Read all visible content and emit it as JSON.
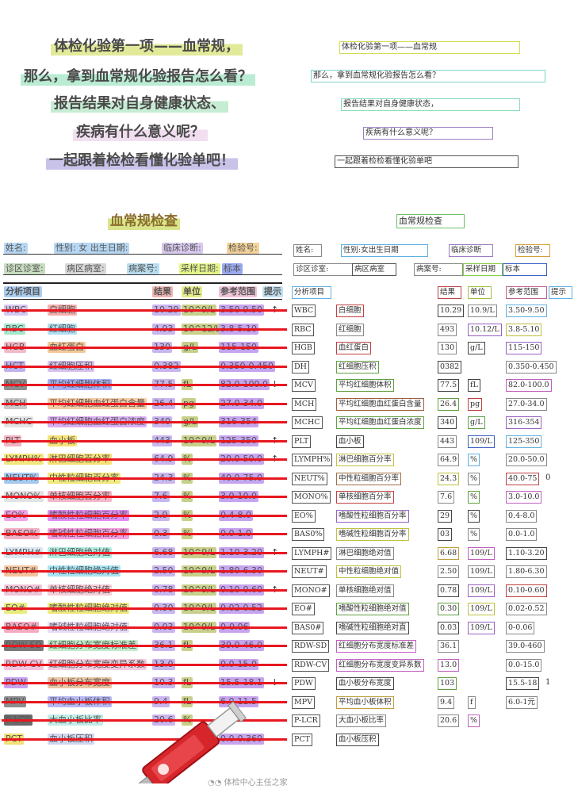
{
  "intro": {
    "line1": "体检化验第一项——血常规，",
    "line2": "那么，拿到血常规化验报告怎么看？",
    "line3": "报告结果对自身健康状态、",
    "line4": "疾病有什么意义呢？",
    "line5": "一起跟着检检看懂化验单吧！"
  },
  "intro_boxes": {
    "line1": "体检化验第一项——血常规",
    "line2": "那么，拿到血常规化验报告怎么看？",
    "line3": "报告结果对自身健康状态，",
    "line4": "疾病有什么意义呢？",
    "line5": "一起跟着检检看懂化验单吧"
  },
  "report": {
    "title": "血常规检查",
    "title_box": "血常规检查",
    "info1": {
      "name": "姓名:",
      "gender_birth": "性别: 女  出生日期:",
      "diagnosis": "临床诊断:",
      "exam_no": "检验号:"
    },
    "info2": {
      "clinic": "诊区诊室:",
      "ward": "病区病室:",
      "case_no": "病案号:",
      "sample_date": "采样日期:",
      "specimen": "标本"
    },
    "info1_boxes": {
      "name": "姓名:",
      "gender_birth": "性别:女出生日期",
      "diagnosis": "临床诊断",
      "exam_no": "检验号:"
    },
    "info2_boxes": {
      "clinic": "诊区诊室:",
      "ward": "病区病室",
      "case_no": "病案号:",
      "sample_date": "采样日期",
      "specimen": "标本"
    },
    "headers": {
      "item": "分析项目",
      "result": "结果",
      "unit": "单位",
      "range": "参考范围",
      "hint": "提示"
    },
    "header_boxes": {
      "item": "分析项目",
      "result": "结果",
      "unit": "单位",
      "range": "参考范围",
      "hint": "提示"
    }
  },
  "rows": [
    {
      "code": "WBC",
      "name": "白细胞",
      "result": "10.29",
      "unit": "10^9/L",
      "range": "3.50-9.50",
      "flag": "↑",
      "r_code": "WBC",
      "r_name": "白细胞",
      "r_result": "10.29",
      "r_unit": "10.9/L",
      "r_range": "3.50-9.50",
      "r_extra": ""
    },
    {
      "code": "RBC",
      "name": "红细胞",
      "result": "4.93",
      "unit": "10^12/L",
      "range": "3.8-5.10",
      "flag": "",
      "r_code": "RBC",
      "r_name": "红细胞",
      "r_result": "493",
      "r_unit": "10.12/L",
      "r_range": "3.8-5.10",
      "r_extra": ""
    },
    {
      "code": "HGB",
      "name": "血红蛋白",
      "result": "130",
      "unit": "g/L",
      "range": "115-150",
      "flag": "",
      "r_code": "HGB",
      "r_name": "血红蛋白",
      "r_result": "130",
      "r_unit": "g/L",
      "r_range": "115-150",
      "r_extra": ""
    },
    {
      "code": "HCT",
      "name": "红细胞压积",
      "result": "0.382",
      "unit": "",
      "range": "0.350-0.450",
      "flag": "",
      "r_code": "DH",
      "r_name": "红细胞压积",
      "r_result": "0382",
      "r_unit": "",
      "r_range": "0.350-0.450",
      "r_extra": ""
    },
    {
      "code": "MCV",
      "name": "平均红细胞体积",
      "result": "77.5",
      "unit": "fL",
      "range": "82.0-100.0",
      "flag": "↓",
      "r_code": "MCV",
      "r_name": "平均红细胞体积",
      "r_result": "77.5",
      "r_unit": "fL",
      "r_range": "82.0-100.0",
      "r_extra": ""
    },
    {
      "code": "MCH",
      "name": "平均红细胞血红蛋白含量",
      "result": "26.4",
      "unit": "pg",
      "range": "27.0-34.0",
      "flag": "",
      "r_code": "MCH",
      "r_name": "平均红细胞血红蛋白含量",
      "r_result": "26.4",
      "r_unit": "pg",
      "r_range": "27.0-34.0",
      "r_extra": ""
    },
    {
      "code": "MCHC",
      "name": "平均红细胞血红蛋白浓度",
      "result": "340",
      "unit": "g/L",
      "range": "316-354",
      "flag": "",
      "r_code": "MCHC",
      "r_name": "平均红细胞血红蛋白浓度",
      "r_result": "340",
      "r_unit": "g/L",
      "r_range": "316-354",
      "r_extra": ""
    },
    {
      "code": "PLT",
      "name": "血小板",
      "result": "443",
      "unit": "10^9/L",
      "range": "125-350",
      "flag": "↑",
      "r_code": "PLT",
      "r_name": "血小板",
      "r_result": "443",
      "r_unit": "109/L",
      "r_range": "125-350",
      "r_extra": ""
    },
    {
      "code": "LYMPH%",
      "name": "淋巴细胞百分率",
      "result": "64.9",
      "unit": "%",
      "range": "20.0-50.0",
      "flag": "↑",
      "r_code": "LYMPH%",
      "r_name": "淋巴细胞百分率",
      "r_result": "64.9",
      "r_unit": "%",
      "r_range": "20.0-50.0",
      "r_extra": ""
    },
    {
      "code": "NEUT%",
      "name": "中性粒细胞百分率",
      "result": "24.3",
      "unit": "%",
      "range": "40.0-75.0",
      "flag": "",
      "r_code": "NEUT%",
      "r_name": "中性粒细胞百分率",
      "r_result": "24.3",
      "r_unit": "%",
      "r_range": "40.0-75",
      "r_extra": "0"
    },
    {
      "code": "MONO%",
      "name": "单核细胞百分率",
      "result": "7.6",
      "unit": "%",
      "range": "3.0-10.0",
      "flag": "",
      "r_code": "MONO%",
      "r_name": "单核细胞百分率",
      "r_result": "7.6",
      "r_unit": "%",
      "r_range": "3.0-10.0",
      "r_extra": ""
    },
    {
      "code": "EO%",
      "name": "嗜酸性粒细胞百分率",
      "result": "2.9",
      "unit": "%",
      "range": "0.4-8.0",
      "flag": "",
      "r_code": "EO%",
      "r_name": "嗜酸性粒细胞百分率",
      "r_result": "29",
      "r_unit": "%",
      "r_range": "0.4-8.0",
      "r_extra": ""
    },
    {
      "code": "BASO%",
      "name": "嗜碱性粒细胞百分率",
      "result": "0.3",
      "unit": "%",
      "range": "0.0-1.0",
      "flag": "",
      "r_code": "BAS0%",
      "r_name": "嗜碱性粒细胞百分率",
      "r_result": "03",
      "r_unit": "%",
      "r_range": "0.0-1.0",
      "r_extra": ""
    },
    {
      "code": "LYMPH#",
      "name": "淋巴细胞绝对值",
      "result": "6.68",
      "unit": "10^9/L",
      "range": "1.10-3.20",
      "flag": "↑",
      "r_code": "LYMPH#",
      "r_name": "淋巴细胞绝对值",
      "r_result": "6.68",
      "r_unit": "109/L",
      "r_range": "1.10-3.20",
      "r_extra": ""
    },
    {
      "code": "NEUT#",
      "name": "中性粒细胞绝对值",
      "result": "2.50",
      "unit": "10^9/L",
      "range": "1.80-6.30",
      "flag": "",
      "r_code": "NEUT#",
      "r_name": "中性粒细胞绝对值",
      "r_result": "2.50",
      "r_unit": "109/L",
      "r_range": "1.80-6.30",
      "r_extra": ""
    },
    {
      "code": "MONO#",
      "name": "单核细胞绝对值",
      "result": "0.78",
      "unit": "10^9/L",
      "range": "0.10-0.60",
      "flag": "↑",
      "r_code": "MONO#",
      "r_name": "单核细胞绝对值",
      "r_result": "0.78",
      "r_unit": "109/L",
      "r_range": "0.10-0.60",
      "r_extra": ""
    },
    {
      "code": "EO#",
      "name": "嗜酸性粒细胞绝对值",
      "result": "0.30",
      "unit": "10^9/L",
      "range": "0.02-0.52",
      "flag": "",
      "r_code": "EO#",
      "r_name": "嗜酸性粒细胞绝对值",
      "r_result": "0.30",
      "r_unit": "109/L",
      "r_range": "0.02-0.52",
      "r_extra": ""
    },
    {
      "code": "BASO#",
      "name": "嗜碱性粒细胞绝对值",
      "result": "0.03",
      "unit": "10^9/L",
      "range": "0-0.06",
      "flag": "",
      "r_code": "BAS0#",
      "r_name": "嗜碱性粒细胞绝对直",
      "r_result": "0.03",
      "r_unit": "109/L",
      "r_range": "0-0.06",
      "r_extra": ""
    },
    {
      "code": "RDW-SD",
      "name": "红细胞分布宽度标准差",
      "result": "36.1",
      "unit": "fL",
      "range": "39.0-46.0",
      "flag": "",
      "r_code": "RDW-SD",
      "r_name": "红细胞分布宽度标准差",
      "r_result": "36.1",
      "r_unit": "",
      "r_range": "39.0-460",
      "r_extra": ""
    },
    {
      "code": "RDW-CV",
      "name": "红细胞分布宽度变异系数",
      "result": "13.0",
      "unit": "",
      "range": "0.0-15.0",
      "flag": "",
      "r_code": "RDW-CV",
      "r_name": "红细胞分布宽度变异系数",
      "r_result": "13.0",
      "r_unit": "",
      "r_range": "0.0-15.0",
      "r_extra": ""
    },
    {
      "code": "PDW",
      "name": "血小板分布宽度",
      "result": "10.3",
      "unit": "fL",
      "range": "15.5-18.1",
      "flag": "↓",
      "r_code": "PDW",
      "r_name": "血小板分布宽度",
      "r_result": "103",
      "r_unit": "",
      "r_range": "15.5-18",
      "r_extra": "1"
    },
    {
      "code": "MPV",
      "name": "平均血小板体积",
      "result": "9.4",
      "unit": "fL",
      "range": "6.0-11.5",
      "flag": "",
      "r_code": "MPV",
      "r_name": "平均血小板体积",
      "r_result": "9.4",
      "r_unit": "f",
      "r_range": "6.0-1元",
      "r_extra": ""
    },
    {
      "code": "P-LCR",
      "name": "大血小板比率",
      "result": "20.6",
      "unit": "%",
      "range": "",
      "flag": "",
      "r_code": "P-LCR",
      "r_name": "大血小板比率",
      "r_result": "20.6",
      "r_unit": "%",
      "r_range": "",
      "r_extra": ""
    },
    {
      "code": "PCT",
      "name": "血小板压积",
      "result": "",
      "unit": "",
      "range": "0.0-0.360",
      "flag": "",
      "r_code": "PCT",
      "r_name": "血小板压积",
      "r_result": "",
      "r_unit": "",
      "r_range": "",
      "r_extra": ""
    }
  ],
  "footer": {
    "watermark": "体检中心主任之家"
  },
  "colors": {
    "strike": "#e8171f",
    "title_highlight": "#d7e48a"
  }
}
